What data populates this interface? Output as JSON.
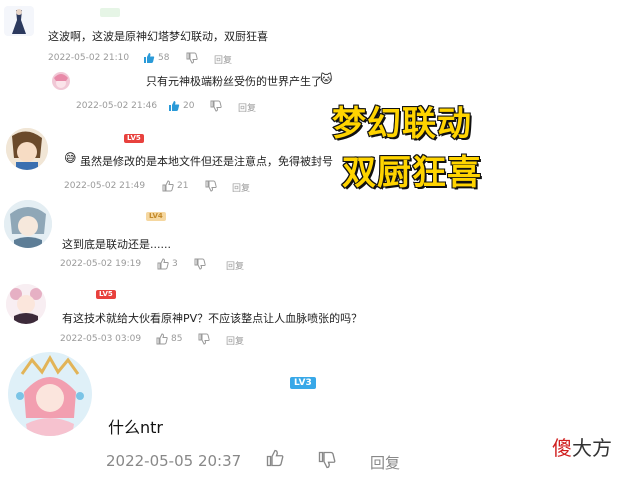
{
  "overlay": {
    "title_line1": "梦幻联动",
    "title_line2": "双厨狂喜"
  },
  "watermark": {
    "accent_char": "傻",
    "rest": "大方"
  },
  "comments": [
    {
      "text": "这波啊，这波是原神幻塔梦幻联动，双厨狂喜",
      "date": "2022-05-02 21:10",
      "likes": "58",
      "reply_label": "回复"
    },
    {
      "text": "只有元神极端粉丝受伤的世界产生了",
      "date": "2022-05-02 21:46",
      "likes": "20",
      "reply_label": "回复"
    },
    {
      "level": "LV5",
      "text": "虽然是修改的是本地文件但还是注意点，免得被封号",
      "date": "2022-05-02 21:49",
      "likes": "21",
      "reply_label": "回复"
    },
    {
      "level": "LV4",
      "text": "这到底是联动还是......",
      "date": "2022-05-02 19:19",
      "likes": "3",
      "reply_label": "回复"
    },
    {
      "level": "LV5",
      "text": "有这技术就给大伙看原神PV？不应该整点让人血脉喷张的吗？",
      "date": "2022-05-03 03:09",
      "likes": "85",
      "reply_label": "回复"
    },
    {
      "level": "LV3",
      "text": "什么ntr",
      "date": "2022-05-05 20:37",
      "reply_label": "回复"
    }
  ],
  "colors": {
    "title_fill": "#ffd400",
    "like_active": "#2a9ad8",
    "meta_gray": "#9a9a9a",
    "level_red": "#e8413d",
    "level_orange": "#f5a623",
    "level_blue": "#38a8e8"
  },
  "icons": [
    "thumbs-up-icon",
    "thumbs-down-icon",
    "emoji-face-icon",
    "cat-emoji-icon"
  ]
}
